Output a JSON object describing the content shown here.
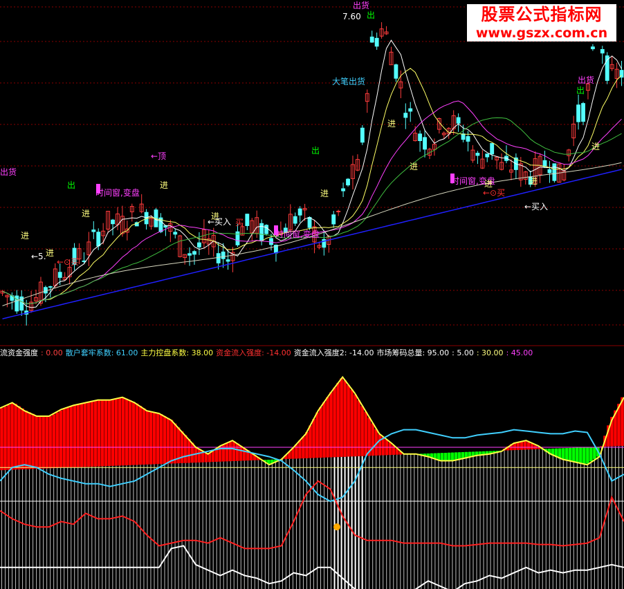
{
  "watermark": {
    "line1": "股票公式指标网",
    "line2": "www.gszx.com.cn"
  },
  "colors": {
    "background": "#000000",
    "up_candle": "#ff3c3c",
    "down_candle": "#54ffff",
    "ma_white": "#ffffff",
    "ma_yellow": "#ffff66",
    "ma_magenta": "#ff40ff",
    "ma_green": "#40c040",
    "ma_long_white": "#d8d8c0",
    "ma_blue": "#2020ff",
    "gridline": "#8b0000",
    "histogram_red": "#ff0000",
    "histogram_green": "#00ff00",
    "histogram_gray": "#c0c0c0",
    "line_yellow": "#ffff44",
    "line_cyan": "#40d0ff",
    "line_red": "#ff2020",
    "line_white": "#ffffff",
    "level_magenta": "#ff40ff",
    "level_yellow": "#ffff80"
  },
  "indicator_legend": [
    {
      "text": "流资金强度",
      "color": "#ffffff"
    },
    {
      "text": ": 0.00",
      "color": "#ff4040"
    },
    {
      "text": "散户套牢系数: 61.00",
      "color": "#40d0ff"
    },
    {
      "text": "主力控盘系数: 38.00",
      "color": "#ffff44"
    },
    {
      "text": "资金流入强度: -14.00",
      "color": "#ff3030"
    },
    {
      "text": "资金流入强度2: -14.00",
      "color": "#ffffff"
    },
    {
      "text": "市场筹码总量: 95.00",
      "color": "#ffffff"
    },
    {
      "text": ": 5.00",
      "color": "#ffffff"
    },
    {
      "text": ": 30.00",
      "color": "#ffff80"
    },
    {
      "text": ": 45.00",
      "color": "#ff40ff"
    }
  ],
  "annotations": [
    {
      "text": "出货",
      "color": "#ff40ff"
    },
    {
      "text": "出",
      "color": "#00ff00"
    },
    {
      "text": "进",
      "color": "#ffff80"
    },
    {
      "text": "进",
      "color": "#ffff80"
    },
    {
      "text": "←5.",
      "color": "#ffffff"
    },
    {
      "text": "←⊙买",
      "color": "#ff3030"
    },
    {
      "text": "进",
      "color": "#ffff80"
    },
    {
      "text": "时间窗,变盘",
      "color": "#ff40ff"
    },
    {
      "text": "←顶",
      "color": "#ff40ff"
    },
    {
      "text": "进",
      "color": "#ffff80"
    },
    {
      "text": "进",
      "color": "#ffff80"
    },
    {
      "text": "←买入",
      "color": "#ffffff"
    },
    {
      "text": "买",
      "color": "#ff3030"
    },
    {
      "text": "时间窗,变盘",
      "color": "#ff40ff"
    },
    {
      "text": "进",
      "color": "#ffff80"
    },
    {
      "text": "出",
      "color": "#00ff00"
    },
    {
      "text": "大笔出货",
      "color": "#40d0ff"
    },
    {
      "text": "出货",
      "color": "#ff40ff"
    },
    {
      "text": "7.60",
      "color": "#ffffff"
    },
    {
      "text": "出",
      "color": "#00ff00"
    },
    {
      "text": "进",
      "color": "#ffff80"
    },
    {
      "text": "进",
      "color": "#ffff80"
    },
    {
      "text": "时间窗,变盘",
      "color": "#ff40ff"
    },
    {
      "text": "进",
      "color": "#ffff80"
    },
    {
      "text": "←⊙买",
      "color": "#ff3030"
    },
    {
      "text": "进",
      "color": "#ffff80"
    },
    {
      "text": "←买入",
      "color": "#ffffff"
    },
    {
      "text": "出货",
      "color": "#ff40ff"
    },
    {
      "text": "出",
      "color": "#00ff00"
    },
    {
      "text": "进",
      "color": "#ffff80"
    }
  ],
  "chart_data": [
    {
      "type": "candlestick",
      "title": "",
      "ylim": [
        0,
        500
      ],
      "grid": true,
      "bar_count": 130,
      "price_path": [
        60,
        50,
        45,
        52,
        75,
        90,
        110,
        120,
        150,
        170,
        165,
        180,
        185,
        175,
        160,
        130,
        120,
        140,
        125,
        110,
        160,
        165,
        150,
        140,
        170,
        180,
        160,
        125,
        170,
        230,
        255,
        440,
        470,
        410,
        340,
        300,
        290,
        320,
        320,
        300,
        260,
        285,
        250,
        255,
        240,
        250,
        265,
        230,
        320,
        350,
        470,
        390,
        400
      ],
      "ma_lines": [
        "white",
        "yellow",
        "magenta",
        "green",
        "long_white",
        "blue"
      ]
    },
    {
      "type": "area",
      "title": "",
      "legend": "top-left",
      "series": [
        {
          "name": "资金流入强度",
          "color": "#ffff44",
          "values": [
            74,
            78,
            72,
            68,
            68,
            73,
            76,
            78,
            80,
            80,
            82,
            78,
            72,
            70,
            65,
            55,
            45,
            40,
            46,
            50,
            44,
            38,
            32,
            36,
            45,
            55,
            72,
            85,
            97,
            85,
            70,
            55,
            48,
            40,
            40,
            38,
            35,
            35,
            37,
            39,
            40,
            42,
            48,
            50,
            46,
            40,
            36,
            34,
            32,
            38,
            65,
            82
          ]
        },
        {
          "name": "散户套牢系数",
          "color": "#40d0ff",
          "values": [
            20,
            30,
            32,
            30,
            25,
            22,
            20,
            18,
            18,
            16,
            18,
            20,
            25,
            30,
            35,
            38,
            40,
            42,
            44,
            44,
            42,
            40,
            38,
            35,
            28,
            20,
            10,
            5,
            8,
            20,
            40,
            50,
            55,
            58,
            58,
            56,
            54,
            52,
            52,
            54,
            55,
            56,
            58,
            57,
            56,
            55,
            55,
            57,
            56,
            40,
            20,
            25
          ]
        },
        {
          "name": "主力控盘系数",
          "color": "#ff2020",
          "values": [
            -2,
            -8,
            -12,
            -14,
            -14,
            -10,
            -12,
            -4,
            -8,
            -8,
            -6,
            -10,
            -20,
            -28,
            -26,
            -24,
            -24,
            -26,
            -22,
            -26,
            -30,
            -30,
            -30,
            -28,
            -10,
            10,
            20,
            14,
            -6,
            -20,
            -24,
            -24,
            -24,
            -26,
            -26,
            -26,
            -26,
            -28,
            -28,
            -27,
            -26,
            -26,
            -26,
            -26,
            -27,
            -27,
            -28,
            -27,
            -26,
            -22,
            8,
            -10
          ]
        },
        {
          "name": "资金流入强度2",
          "color": "#ffffff",
          "values": [
            -44,
            -44,
            -44,
            -44,
            -44,
            -44,
            -44,
            -44,
            -44,
            -44,
            -44,
            -44,
            -44,
            -44,
            -30,
            -28,
            -42,
            -46,
            -50,
            -46,
            -50,
            -52,
            -56,
            -54,
            -48,
            -50,
            -44,
            -44,
            -52,
            -60,
            -64,
            -64,
            -70,
            -66,
            -60,
            -54,
            -58,
            -62,
            -56,
            -54,
            -50,
            -52,
            -48,
            -44,
            -48,
            -46,
            -48,
            -46,
            -46,
            -44,
            -42,
            -44
          ]
        }
      ],
      "levels": [
        {
          "value": 5.0,
          "color": "#ffffff"
        },
        {
          "value": 30.0,
          "color": "#ffff80"
        },
        {
          "value": 45.0,
          "color": "#ff40ff"
        }
      ],
      "ylim": [
        -60,
        110
      ]
    }
  ]
}
